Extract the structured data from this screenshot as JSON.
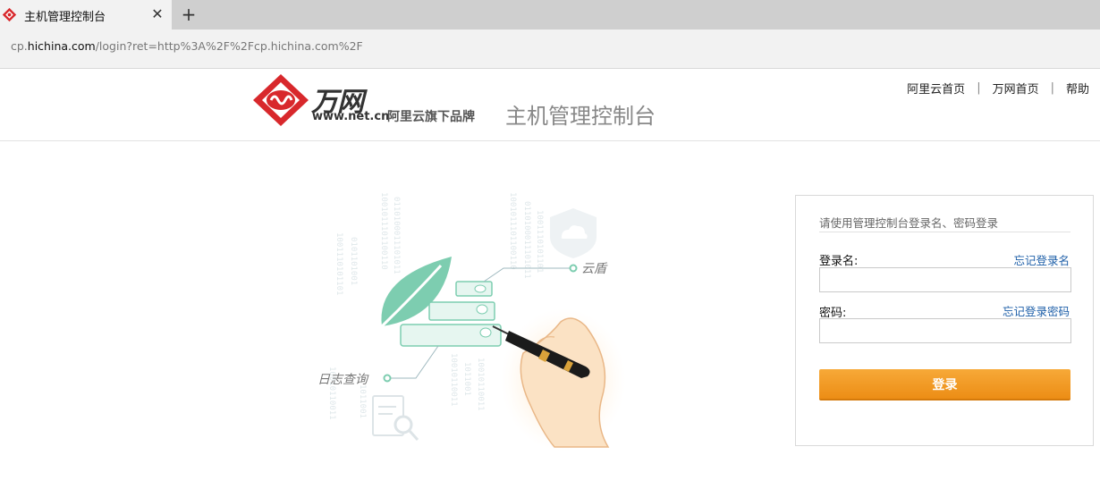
{
  "browser": {
    "tab_title": "主机管理控制台",
    "tab_close_icon": "close-icon",
    "new_tab_icon": "plus-icon",
    "url_prefix": "cp.",
    "url_host": "hichina.com",
    "url_path": "/login?ret=http%3A%2F%2Fcp.hichina.com%2F"
  },
  "header": {
    "brand": "万网",
    "brand_url": "www.net.cn",
    "slogan": "阿里云旗下品牌",
    "console_title": "主机管理控制台",
    "nav": [
      "阿里云首页",
      "万网首页",
      "帮助"
    ],
    "nav_separator": "|"
  },
  "illustration": {
    "label_cloud_shield": "云盾",
    "label_log_query": "日志查询",
    "binary_text": [
      "1001110101101",
      "0101101001",
      "1001011101100110",
      "0110100011101011",
      "10010110011",
      "1011001"
    ]
  },
  "login": {
    "hint": "请使用管理控制台登录名、密码登录",
    "username_label": "登录名:",
    "forgot_username": "忘记登录名",
    "username_value": "",
    "password_label": "密码:",
    "forgot_password": "忘记登录密码",
    "password_value": "",
    "submit_label": "登录"
  },
  "colors": {
    "brand_red": "#d8282c",
    "button_orange": "#f29b22",
    "link_blue": "#1e5fa8",
    "leaf_green": "#7dcdb0"
  }
}
